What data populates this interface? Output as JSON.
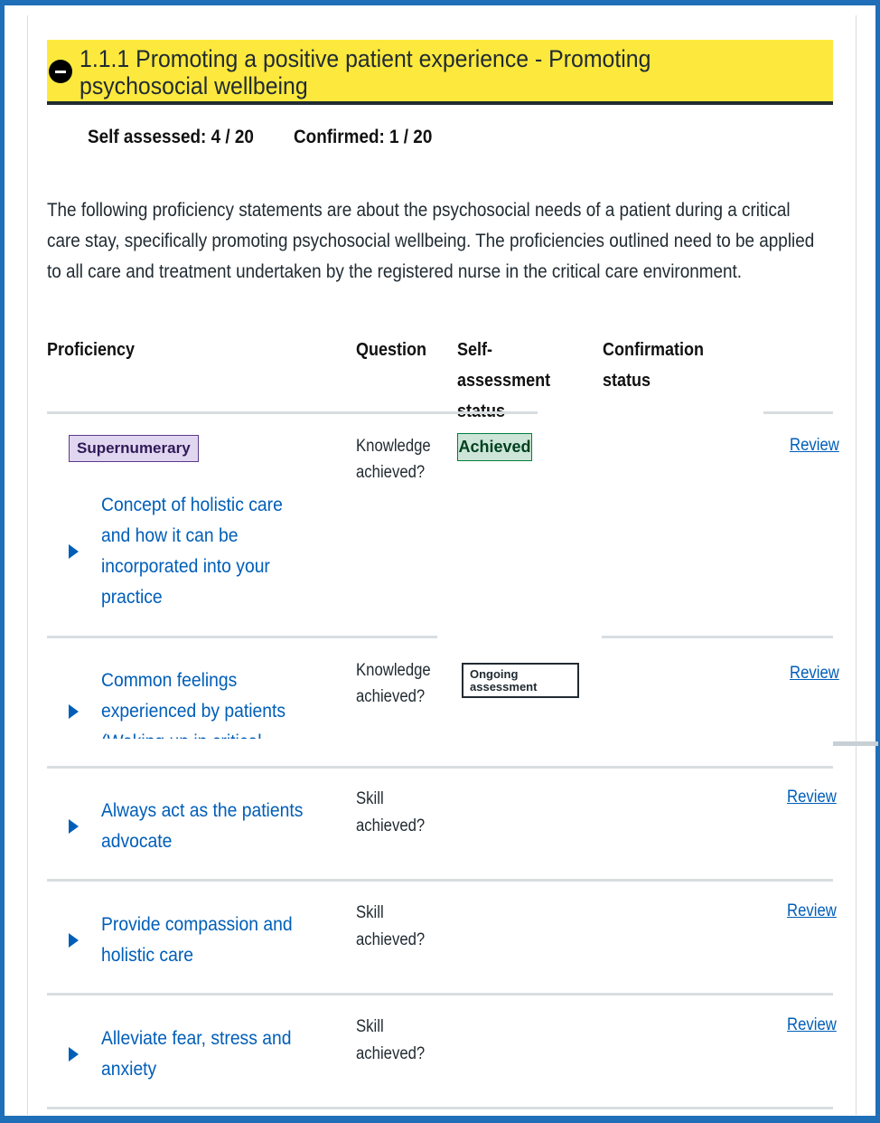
{
  "section": {
    "title": "1.1.1 Promoting a positive patient experience - Promoting psychosocial wellbeing",
    "self_assessed": "Self assessed: 4 / 20",
    "confirmed": "Confirmed: 1 / 20",
    "intro": "The following proficiency statements are about the psychosocial needs of a patient during a critical care stay, specifically promoting psychosocial wellbeing. The proficiencies outlined need to be applied to all care and treatment undertaken by the registered nurse in the critical care environment."
  },
  "table": {
    "headers": {
      "proficiency": "Proficiency",
      "question": "Question",
      "self_assessment": "Self-assessment status",
      "confirmation": "Confirmation status"
    },
    "rows": [
      {
        "tag": "Supernumerary",
        "lines": [
          "Concept of holistic care",
          "and how it can be",
          "incorporated into your",
          "practice"
        ],
        "question": [
          "Knowledge",
          "achieved?"
        ],
        "self_status": "Achieved",
        "review": "Review"
      },
      {
        "lines": [
          "Common feelings",
          "experienced by patients",
          "(Waking up in critical"
        ],
        "question": [
          "Knowledge",
          "achieved?"
        ],
        "self_status": "Ongoing assessment",
        "review": "Review"
      },
      {
        "lines": [
          "Always act as the patients",
          "advocate"
        ],
        "question": [
          "Skill",
          "achieved?"
        ],
        "review": "Review"
      },
      {
        "lines": [
          "Provide compassion and",
          "holistic care"
        ],
        "question": [
          "Skill",
          "achieved?"
        ],
        "review": "Review"
      },
      {
        "lines": [
          "Alleviate fear, stress and",
          "anxiety"
        ],
        "question": [
          "Skill",
          "achieved?"
        ],
        "review": "Review"
      }
    ]
  },
  "colors": {
    "frame_blue": "#1f6fb8",
    "header_yellow": "#fde93d",
    "link_blue": "#005eb8",
    "achieved_bg": "#cce5d8",
    "supernumerary_bg": "#e1d6f0"
  }
}
